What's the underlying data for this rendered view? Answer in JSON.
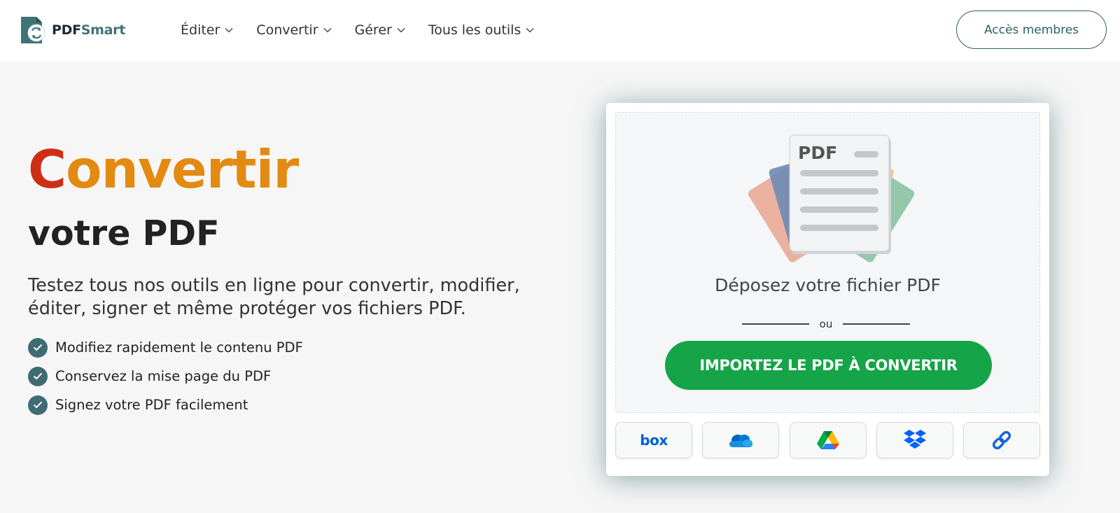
{
  "header": {
    "logo": {
      "part1": "PDF",
      "part2": "Smart"
    },
    "nav": [
      {
        "label": "Éditer",
        "icon": "chevron-down-icon"
      },
      {
        "label": "Convertir",
        "icon": "chevron-down-icon"
      },
      {
        "label": "Gérer",
        "icon": "chevron-down-icon"
      },
      {
        "label": "Tous les outils",
        "icon": "chevron-down-icon"
      }
    ],
    "member_button": "Accès membres"
  },
  "hero": {
    "title_first_letter": "C",
    "title_rest": "onvertir",
    "subtitle": "votre PDF",
    "description": "Testez tous nos outils en ligne pour convertir, modifier, éditer, signer et même protéger vos fichiers PDF.",
    "features": [
      "Modifiez rapidement le contenu PDF",
      "Conservez la mise page du PDF",
      "Signez votre PDF facilement"
    ]
  },
  "upload": {
    "doc_label": "PDF",
    "drop_text": "Déposez votre fichier PDF",
    "or_text": "ou",
    "import_button": "IMPORTEZ LE PDF À CONVERTIR",
    "sources": [
      {
        "name": "box",
        "label": "box",
        "icon": "box-logo-icon"
      },
      {
        "name": "onedrive",
        "icon": "onedrive-icon"
      },
      {
        "name": "google-drive",
        "icon": "google-drive-icon"
      },
      {
        "name": "dropbox",
        "icon": "dropbox-icon"
      },
      {
        "name": "link",
        "icon": "link-icon"
      }
    ]
  },
  "colors": {
    "accent_red": "#cd2e15",
    "accent_orange": "#e38a12",
    "teal": "#3f6b73",
    "button_green": "#15a448"
  }
}
